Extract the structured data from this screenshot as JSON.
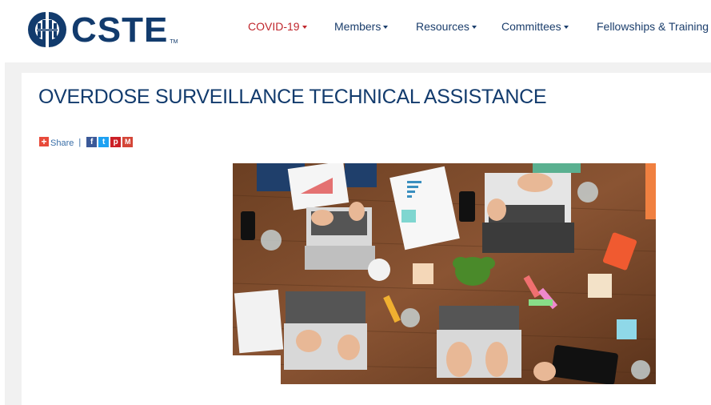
{
  "header": {
    "logo_text": "CSTE",
    "logo_tm": "TM"
  },
  "nav": {
    "items": [
      {
        "label": "COVID-19",
        "active": true
      },
      {
        "label": "Members",
        "active": false
      },
      {
        "label": "Resources",
        "active": false
      },
      {
        "label": "Committees",
        "active": false
      },
      {
        "label": "Fellowships & Training",
        "active": false
      }
    ]
  },
  "page": {
    "title": "OVERDOSE SURVEILLANCE TECHNICAL ASSISTANCE"
  },
  "share": {
    "label": "Share",
    "separator": "|",
    "buttons": [
      {
        "icon": "facebook-icon",
        "glyph": "f",
        "color": "#3b5998"
      },
      {
        "icon": "twitter-icon",
        "glyph": "t",
        "color": "#1da1f2"
      },
      {
        "icon": "pinterest-icon",
        "glyph": "p",
        "color": "#cb2027"
      },
      {
        "icon": "gmail-icon",
        "glyph": "M",
        "color": "#d44638"
      }
    ]
  },
  "colors": {
    "brand_navy": "#123b6d",
    "nav_active": "#c0272d",
    "nav_text": "#1b3e6c",
    "share_plus": "#e84a3a",
    "page_gray": "#f1f1f1"
  }
}
